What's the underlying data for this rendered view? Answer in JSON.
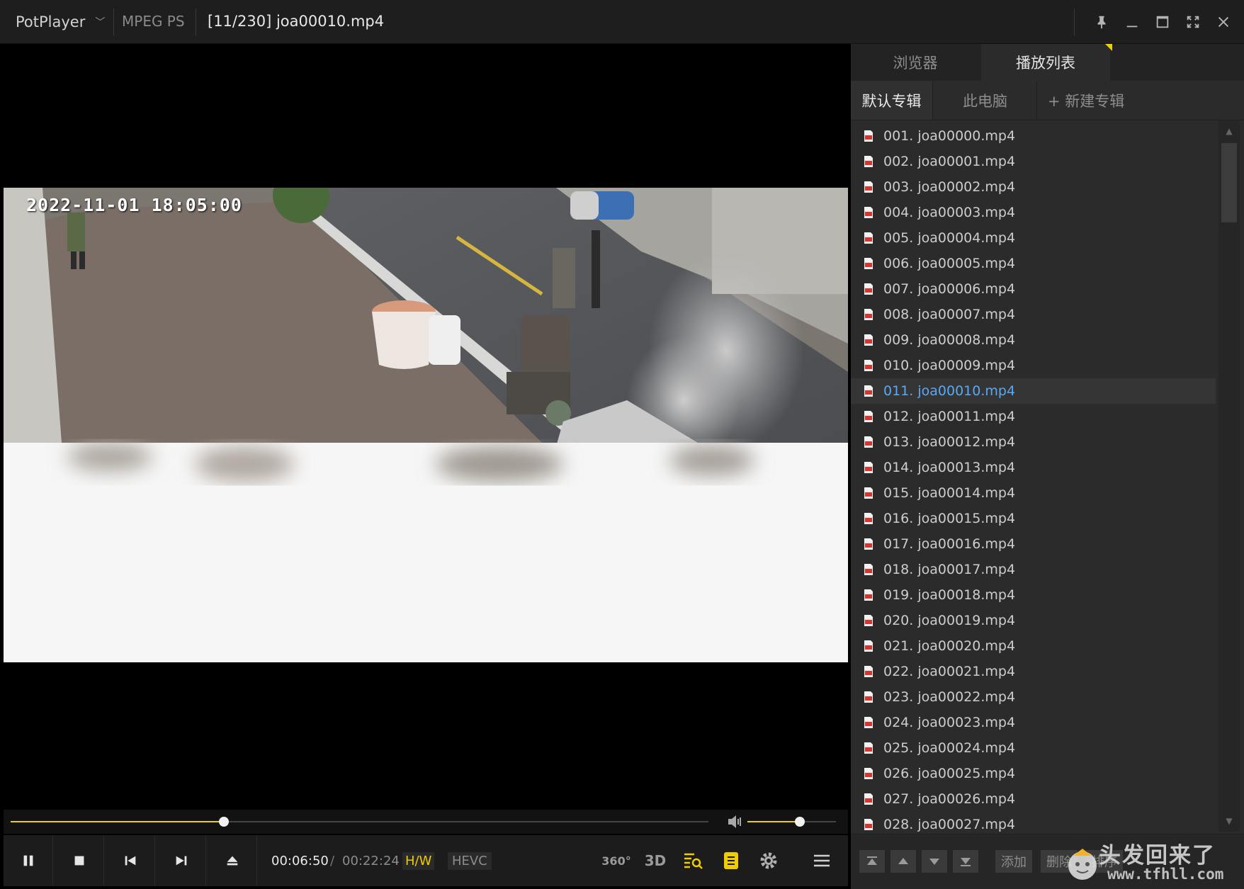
{
  "titlebar": {
    "app_name": "PotPlayer",
    "format": "MPEG PS",
    "file_title": "[11/230] joa00010.mp4"
  },
  "video": {
    "timestamp": "2022-11-01  18:05:00"
  },
  "player": {
    "seek_fraction": 0.306,
    "volume_fraction": 0.59,
    "current_time": "00:06:50",
    "time_separator": "/",
    "total_time": "00:22:24",
    "hw_badge": "H/W",
    "codec_badge": "HEVC",
    "label_360": "360°",
    "label_3d": "3D"
  },
  "panel": {
    "tabs": [
      {
        "label": "浏览器",
        "active": false
      },
      {
        "label": "播放列表",
        "active": true
      }
    ],
    "albums": [
      {
        "label": "默认专辑",
        "active": true
      },
      {
        "label": "此电脑",
        "active": false
      }
    ],
    "new_album": "+ 新建专辑",
    "playlist": [
      {
        "label": "001. joa00000.mp4"
      },
      {
        "label": "002. joa00001.mp4"
      },
      {
        "label": "003. joa00002.mp4"
      },
      {
        "label": "004. joa00003.mp4"
      },
      {
        "label": "005. joa00004.mp4"
      },
      {
        "label": "006. joa00005.mp4"
      },
      {
        "label": "007. joa00006.mp4"
      },
      {
        "label": "008. joa00007.mp4"
      },
      {
        "label": "009. joa00008.mp4"
      },
      {
        "label": "010. joa00009.mp4"
      },
      {
        "label": "011. joa00010.mp4",
        "current": true
      },
      {
        "label": "012. joa00011.mp4"
      },
      {
        "label": "013. joa00012.mp4"
      },
      {
        "label": "014. joa00013.mp4"
      },
      {
        "label": "015. joa00014.mp4"
      },
      {
        "label": "016. joa00015.mp4"
      },
      {
        "label": "017. joa00016.mp4"
      },
      {
        "label": "018. joa00017.mp4"
      },
      {
        "label": "019. joa00018.mp4"
      },
      {
        "label": "020. joa00019.mp4"
      },
      {
        "label": "021. joa00020.mp4"
      },
      {
        "label": "022. joa00021.mp4"
      },
      {
        "label": "023. joa00022.mp4"
      },
      {
        "label": "024. joa00023.mp4"
      },
      {
        "label": "025. joa00024.mp4"
      },
      {
        "label": "026. joa00025.mp4"
      },
      {
        "label": "027. joa00026.mp4"
      },
      {
        "label": "028. joa00027.mp4"
      }
    ],
    "footer": {
      "add_label": "添加",
      "delete_label": "删除",
      "sort_label": "排序"
    },
    "watermark": {
      "text": "头发回来了",
      "url": "www.tfhll.com"
    }
  },
  "colors": {
    "accent_yellow": "#f0d000",
    "current_item_blue": "#5aa9f4"
  }
}
